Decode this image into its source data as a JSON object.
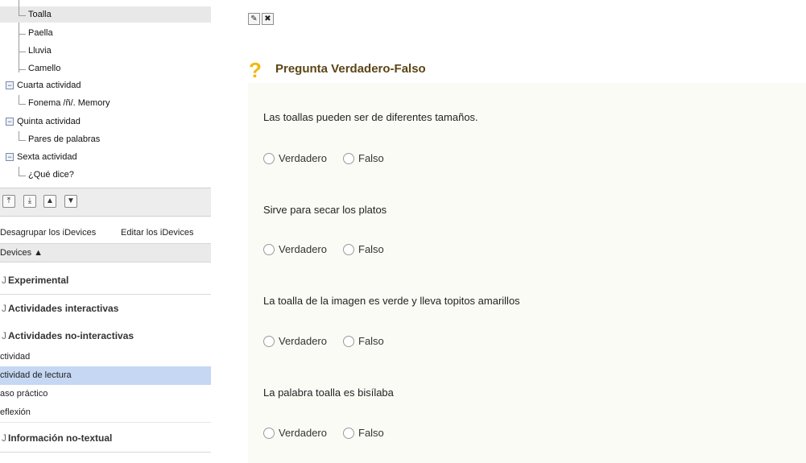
{
  "sidebar": {
    "tree": [
      {
        "type": "leaf",
        "label": "Toalla",
        "selected": true
      },
      {
        "type": "leaf",
        "label": "Paella"
      },
      {
        "type": "leaf",
        "label": "Lluvia"
      },
      {
        "type": "leaf",
        "label": "Camello"
      },
      {
        "type": "parent",
        "label": "Cuarta actividad"
      },
      {
        "type": "leaf",
        "label": "Fonema /ñ/. Memory"
      },
      {
        "type": "parent",
        "label": "Quinta actividad"
      },
      {
        "type": "leaf",
        "label": "Pares de palabras"
      },
      {
        "type": "parent",
        "label": "Sexta actividad"
      },
      {
        "type": "leaf",
        "label": "¿Qué dice?"
      }
    ],
    "tree_toggle_symbol": "−",
    "toolbar_buttons": [
      {
        "name": "move-top-icon",
        "glyph": "⤒"
      },
      {
        "name": "move-bottom-icon",
        "glyph": "⤓"
      },
      {
        "name": "move-up-icon",
        "glyph": "▲"
      },
      {
        "name": "move-down-icon",
        "glyph": "▼"
      }
    ],
    "actions": {
      "ungroup": "Desagrupar los iDevices",
      "edit": "Editar los iDevices"
    },
    "idevices_header": "Devices ▲",
    "categories": [
      {
        "label": "Experimental",
        "mark": "J"
      },
      {
        "label": "Actividades interactivas",
        "mark": "J"
      },
      {
        "label": "Actividades no-interactivas",
        "mark": "J"
      }
    ],
    "sub_items": [
      {
        "label": "ctividad"
      },
      {
        "label": "ctividad de lectura",
        "selected": true
      },
      {
        "label": "aso práctico"
      },
      {
        "label": "eflexión"
      }
    ],
    "bottom_category": {
      "label": "Información no-textual",
      "mark": "J"
    }
  },
  "main": {
    "edit_icons": [
      {
        "name": "edit-icon",
        "glyph": "✎"
      },
      {
        "name": "delete-icon",
        "glyph": "✖"
      }
    ],
    "question_icon_glyph": "?",
    "title": "Pregunta Verdadero-Falso",
    "questions": [
      {
        "text": "Las toallas pueden ser de diferentes tamaños.",
        "true_label": "Verdadero",
        "false_label": "Falso"
      },
      {
        "text": "Sirve para secar los platos",
        "true_label": "Verdadero",
        "false_label": "Falso"
      },
      {
        "text": "La toalla de la imagen es verde y lleva topitos amarillos",
        "true_label": "Verdadero",
        "false_label": "Falso"
      },
      {
        "text": "La palabra toalla es bisílaba",
        "true_label": "Verdadero",
        "false_label": "Falso"
      }
    ]
  },
  "colors": {
    "selected_tree_row": "#e8e8e8",
    "selected_idevice": "#c5d7f2",
    "question_icon": "#f1b80c",
    "title_text": "#5c4616",
    "panel_bg": "#fbfbf5"
  }
}
